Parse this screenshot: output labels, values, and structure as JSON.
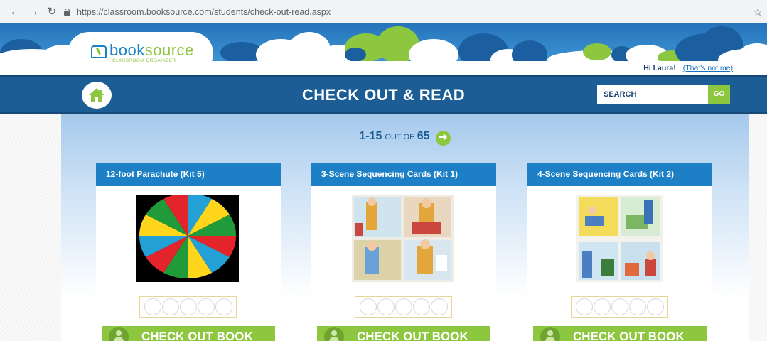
{
  "browser": {
    "url": "https://classroom.booksource.com/students/check-out-read.aspx"
  },
  "logo": {
    "name_part1": "book",
    "name_part2": "source",
    "subtitle": "CLASSROOM ORGANIZER"
  },
  "user": {
    "greeting": "Hi Laura!",
    "not_me_link": "(That's not me)"
  },
  "header": {
    "title": "CHECK OUT & READ",
    "search_placeholder": "SEARCH",
    "go_label": "GO"
  },
  "pager": {
    "range": "1-15",
    "out_of": "OUT OF",
    "total": "65"
  },
  "books": [
    {
      "title": "12-foot Parachute (Kit 5)",
      "rating_stars": 5,
      "button": "CHECK OUT BOOK"
    },
    {
      "title": "3-Scene Sequencing Cards (Kit 1)",
      "rating_stars": 5,
      "button": "CHECK OUT BOOK"
    },
    {
      "title": "4-Scene Sequencing Cards (Kit 2)",
      "rating_stars": 5,
      "button": "CHECK OUT BOOK"
    }
  ],
  "colors": {
    "header_blue": "#1d5d96",
    "card_head_blue": "#1d80c6",
    "accent_green": "#8dc63f"
  }
}
